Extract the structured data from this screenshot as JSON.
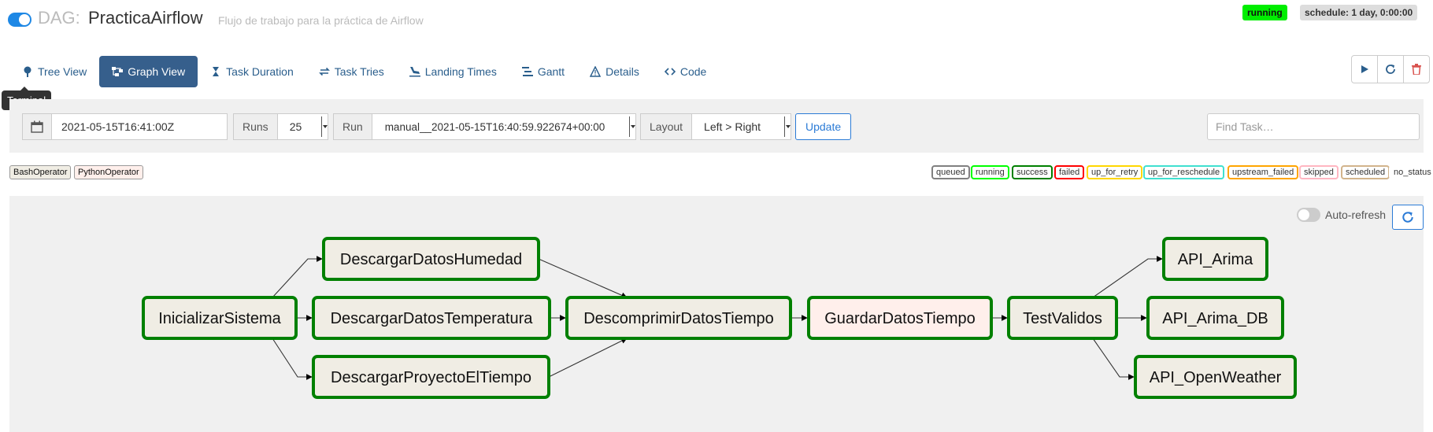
{
  "header": {
    "dag_label": "DAG:",
    "dag_id": "PracticaAirflow",
    "description": "Flujo de trabajo para la práctica de Airflow",
    "state_badge": "running",
    "schedule_badge": "schedule: 1 day, 0:00:00"
  },
  "nav": {
    "tabs": [
      {
        "label": "Tree View",
        "icon": "tree-icon",
        "active": false
      },
      {
        "label": "Graph View",
        "icon": "graph-icon",
        "active": true
      },
      {
        "label": "Task Duration",
        "icon": "hourglass-icon",
        "active": false
      },
      {
        "label": "Task Tries",
        "icon": "retry-icon",
        "active": false
      },
      {
        "label": "Landing Times",
        "icon": "landing-icon",
        "active": false
      },
      {
        "label": "Gantt",
        "icon": "gantt-icon",
        "active": false
      },
      {
        "label": "Details",
        "icon": "warning-triangle-icon",
        "active": false
      },
      {
        "label": "Code",
        "icon": "code-icon",
        "active": false
      }
    ],
    "tooltip": "Terminal",
    "actions": [
      {
        "name": "trigger-dag-button",
        "icon": "play-icon",
        "color": "#2a5e8c"
      },
      {
        "name": "refresh-dag-button",
        "icon": "refresh-icon",
        "color": "#2a5e8c"
      },
      {
        "name": "delete-dag-button",
        "icon": "trash-icon",
        "color": "#d9534f"
      }
    ]
  },
  "controls": {
    "base_date": "2021-05-15T16:41:00Z",
    "runs_label": "Runs",
    "runs_value": "25",
    "run_label": "Run",
    "run_value": "manual__2021-05-15T16:40:59.922674+00:00",
    "layout_label": "Layout",
    "layout_value": "Left > Right",
    "update_label": "Update",
    "find_task_placeholder": "Find Task…"
  },
  "operators": [
    {
      "label": "BashOperator",
      "color": "#f0ede4"
    },
    {
      "label": "PythonOperator",
      "color": "#ffefeb"
    }
  ],
  "states": [
    {
      "label": "queued",
      "color": "#808080"
    },
    {
      "label": "running",
      "color": "#00ff00"
    },
    {
      "label": "success",
      "color": "#008000"
    },
    {
      "label": "failed",
      "color": "#ff0000"
    },
    {
      "label": "up_for_retry",
      "color": "#ffd700"
    },
    {
      "label": "up_for_reschedule",
      "color": "#40e0d0"
    },
    {
      "label": "upstream_failed",
      "color": "#ffa500"
    },
    {
      "label": "skipped",
      "color": "#ffb6c1"
    },
    {
      "label": "scheduled",
      "color": "#d2b48c"
    },
    {
      "label": "no_status",
      "color": "none"
    }
  ],
  "graph": {
    "auto_refresh_label": "Auto-refresh",
    "success_color": "#008000",
    "tasks": [
      {
        "id": "InicializarSistema",
        "operator": "BashOperator"
      },
      {
        "id": "DescargarDatosHumedad",
        "operator": "BashOperator"
      },
      {
        "id": "DescargarDatosTemperatura",
        "operator": "BashOperator"
      },
      {
        "id": "DescargarProyectoElTiempo",
        "operator": "BashOperator"
      },
      {
        "id": "DescomprimirDatosTiempo",
        "operator": "BashOperator"
      },
      {
        "id": "GuardarDatosTiempo",
        "operator": "PythonOperator"
      },
      {
        "id": "TestValidos",
        "operator": "BashOperator"
      },
      {
        "id": "API_Arima",
        "operator": "BashOperator"
      },
      {
        "id": "API_Arima_DB",
        "operator": "BashOperator"
      },
      {
        "id": "API_OpenWeather",
        "operator": "BashOperator"
      }
    ],
    "edges": [
      [
        "InicializarSistema",
        "DescargarDatosHumedad"
      ],
      [
        "InicializarSistema",
        "DescargarDatosTemperatura"
      ],
      [
        "InicializarSistema",
        "DescargarProyectoElTiempo"
      ],
      [
        "DescargarDatosHumedad",
        "DescomprimirDatosTiempo"
      ],
      [
        "DescargarDatosTemperatura",
        "DescomprimirDatosTiempo"
      ],
      [
        "DescargarProyectoElTiempo",
        "DescomprimirDatosTiempo"
      ],
      [
        "DescomprimirDatosTiempo",
        "GuardarDatosTiempo"
      ],
      [
        "GuardarDatosTiempo",
        "TestValidos"
      ],
      [
        "TestValidos",
        "API_Arima"
      ],
      [
        "TestValidos",
        "API_Arima_DB"
      ],
      [
        "TestValidos",
        "API_OpenWeather"
      ]
    ]
  }
}
